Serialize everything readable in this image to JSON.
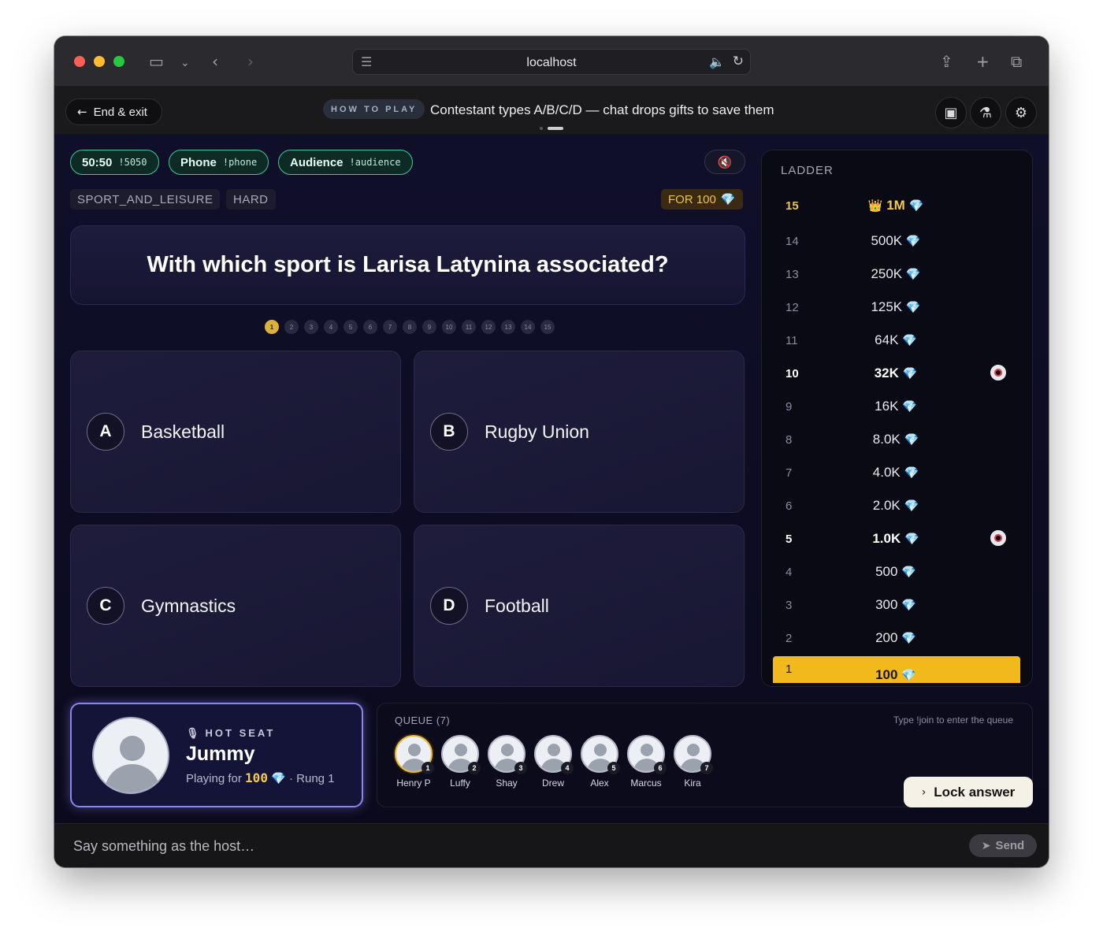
{
  "browser": {
    "url": "localhost"
  },
  "topbar": {
    "end_label": "End & exit",
    "howto_badge": "HOW TO PLAY",
    "howto_text": "Contestant types A/B/C/D — chat drops gifts to save them"
  },
  "lifelines": [
    {
      "label": "50:50",
      "cmd": "!5050"
    },
    {
      "label": "Phone",
      "cmd": "!phone"
    },
    {
      "label": "Audience",
      "cmd": "!audience"
    }
  ],
  "tags": {
    "category": "SPORT_AND_LEISURE",
    "difficulty": "HARD",
    "for_label": "FOR 100"
  },
  "question": {
    "text": "With which sport is Larisa Latynina associated?"
  },
  "progress": {
    "current": 1,
    "labels": [
      "1",
      "2",
      "3",
      "4",
      "5",
      "6",
      "7",
      "8",
      "9",
      "10",
      "11",
      "12",
      "13",
      "14",
      "15"
    ]
  },
  "answers": [
    {
      "letter": "A",
      "text": "Basketball"
    },
    {
      "letter": "B",
      "text": "Rugby Union"
    },
    {
      "letter": "C",
      "text": "Gymnastics"
    },
    {
      "letter": "D",
      "text": "Football"
    }
  ],
  "ladder": {
    "title": "LADDER",
    "rungs": [
      {
        "num": "15",
        "amount": "1M",
        "top": true
      },
      {
        "num": "14",
        "amount": "500K"
      },
      {
        "num": "13",
        "amount": "250K"
      },
      {
        "num": "12",
        "amount": "125K"
      },
      {
        "num": "11",
        "amount": "64K"
      },
      {
        "num": "10",
        "amount": "32K",
        "safe": true
      },
      {
        "num": "9",
        "amount": "16K"
      },
      {
        "num": "8",
        "amount": "8.0K"
      },
      {
        "num": "7",
        "amount": "4.0K"
      },
      {
        "num": "6",
        "amount": "2.0K"
      },
      {
        "num": "5",
        "amount": "1.0K",
        "safe": true
      },
      {
        "num": "4",
        "amount": "500"
      },
      {
        "num": "3",
        "amount": "300"
      },
      {
        "num": "2",
        "amount": "200"
      },
      {
        "num": "1",
        "amount": "100",
        "current": true
      }
    ]
  },
  "hotseat": {
    "label": "HOT SEAT",
    "name": "Jummy",
    "playing_for_prefix": "Playing for",
    "amount": "100",
    "rung_text": "· Rung 1"
  },
  "queue": {
    "title": "QUEUE (7)",
    "hint": "Type !join to enter the queue",
    "players": [
      {
        "pos": "1",
        "name": "Henry P"
      },
      {
        "pos": "2",
        "name": "Luffy"
      },
      {
        "pos": "3",
        "name": "Shay"
      },
      {
        "pos": "4",
        "name": "Drew"
      },
      {
        "pos": "5",
        "name": "Alex"
      },
      {
        "pos": "6",
        "name": "Marcus"
      },
      {
        "pos": "7",
        "name": "Kira"
      }
    ]
  },
  "actions": {
    "lock_label": "Lock answer"
  },
  "chat": {
    "placeholder": "Say something as the host…",
    "send_label": "Send"
  },
  "colors": {
    "accent_gold": "#f2b91c",
    "lifeline_green": "#3fc996",
    "hotseat_border": "#8a86f0",
    "gem_blue": "#5ab8ff"
  }
}
